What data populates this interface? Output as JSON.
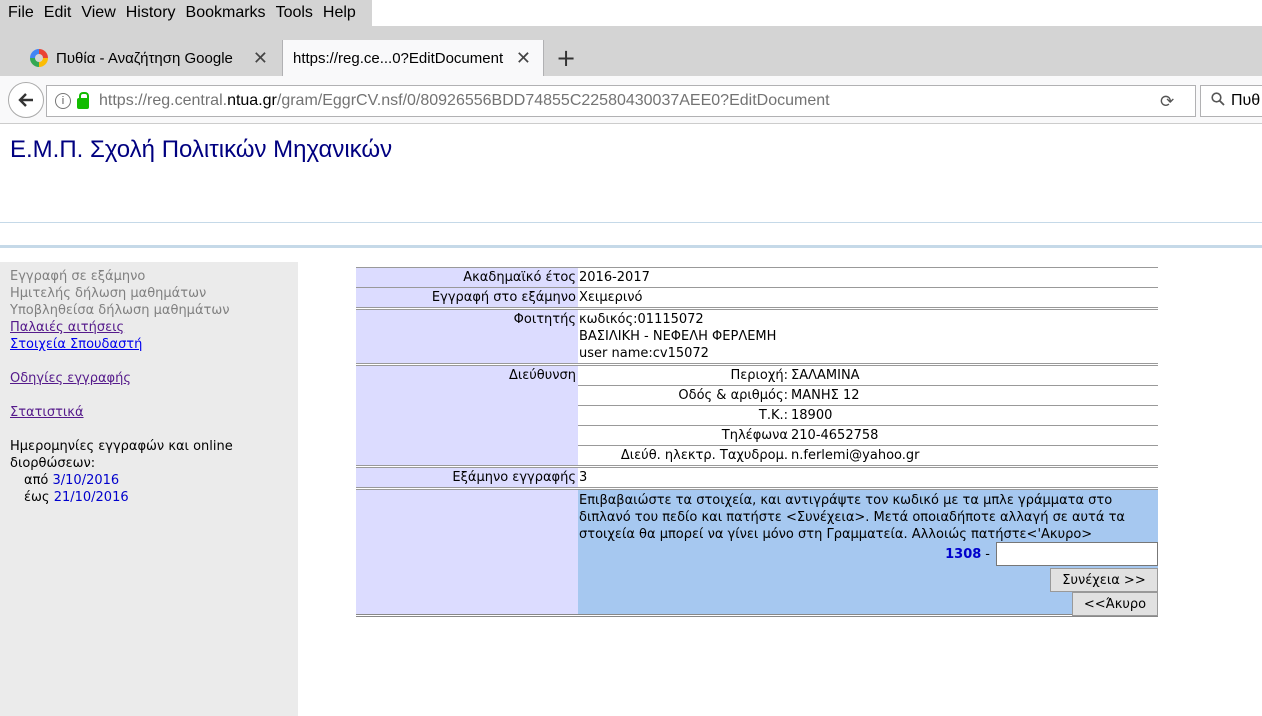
{
  "menu": [
    "File",
    "Edit",
    "View",
    "History",
    "Bookmarks",
    "Tools",
    "Help"
  ],
  "tabs": [
    {
      "label": "Πυθία - Αναζήτηση Google",
      "close": "✕"
    },
    {
      "label": "https://reg.ce...0?EditDocument",
      "close": "✕"
    }
  ],
  "newtab": "+",
  "url": {
    "prefix": "https://reg.central.",
    "host": "ntua.gr",
    "rest": "/gram/EggrCV.nsf/0/80926556BDD74855C22580430037AEE0?EditDocument"
  },
  "search_partial": "Πυθ",
  "page_title": "Ε.Μ.Π. Σχολή Πολιτικών Μηχανικών",
  "sidebar": {
    "disabled": [
      "Εγγραφή σε εξάμηνο",
      "Ημιτελής δήλωση μαθημάτων",
      "Υποβληθείσα δήλωση μαθημάτων"
    ],
    "old_requests": "Παλαιές αιτήσεις",
    "student_info": "Στοιχεία Σπουδαστή",
    "instructions": "Οδηγίες εγγραφής",
    "stats": "Στατιστικά",
    "dates_label": "Ημερομηνίες εγγραφών και online διορθώσεων:",
    "from_label": "από",
    "from_date": "3/10/2016",
    "to_label": "έως",
    "to_date": "21/10/2016"
  },
  "form": {
    "year_label": "Ακαδημαϊκό έτος",
    "year": "2016-2017",
    "semester_reg_label": "Εγγραφή στο εξάμηνο",
    "semester_reg": "Χειμερινό",
    "student_label": "Φοιτητής",
    "student_code": "κωδικός:01115072",
    "student_name": "ΒΑΣΙΛΙΚΗ - ΝΕΦΕΛΗ ΦΕΡΛΕΜΗ",
    "student_user": "user name:cv15072",
    "address_label": "Διεύθυνση",
    "address": [
      {
        "label": "Περιοχή:",
        "value": "ΣΑΛΑΜΙΝΑ"
      },
      {
        "label": "Οδός & αριθμός:",
        "value": "ΜΑΝΗΣ 12"
      },
      {
        "label": "Τ.Κ.:",
        "value": "18900"
      },
      {
        "label": "Τηλέφωνα",
        "value": "210-4652758"
      },
      {
        "label": "Διεύθ. ηλεκτρ. Ταχυδρομ.",
        "value": "n.ferlemi@yahoo.gr"
      }
    ],
    "semester_label": "Εξάμηνο εγγραφής",
    "semester": "3",
    "confirm_msg": "Επιβαβαιώστε τα στοιχεία, και αντιγράψτε τον κωδικό με τα μπλε γράμματα στο διπλανό του πεδίο και πατήστε <Συνέχεια>. Μετά οποιαδήποτε αλλαγή σε αυτά τα στοιχεία θα μπορεί να γίνει μόνο στη Γραμματεία. Αλλοιώς πατήστε<'Ακυρο>",
    "code": "1308",
    "code_sep": "-",
    "next_button": "Συνέχεια >>",
    "cancel_button": "<<Άκυρο"
  }
}
